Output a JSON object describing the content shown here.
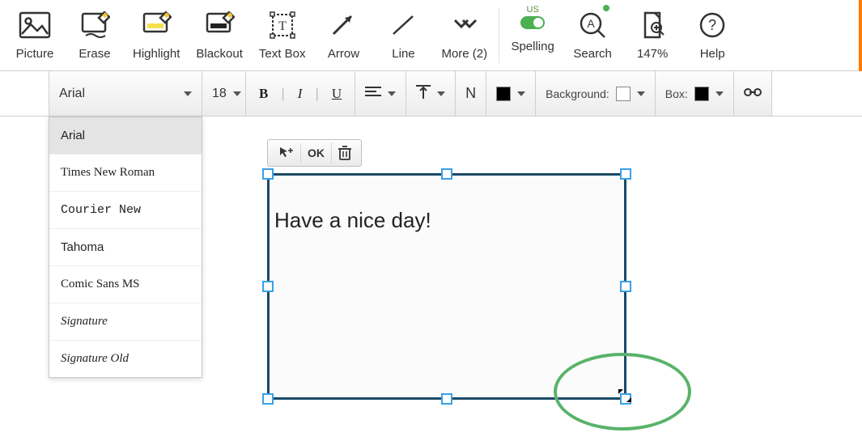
{
  "toolbar": {
    "picture": "Picture",
    "erase": "Erase",
    "highlight": "Highlight",
    "blackout": "Blackout",
    "textbox": "Text Box",
    "arrow": "Arrow",
    "line": "Line",
    "more": "More (2)",
    "spelling": "Spelling",
    "spelling_lang": "us",
    "search": "Search",
    "zoom": "147%",
    "help": "Help"
  },
  "format": {
    "font": "Arial",
    "size": "18",
    "bold": "B",
    "italic": "I",
    "underline": "U",
    "n_label": "N",
    "background_label": "Background:",
    "box_label": "Box:"
  },
  "font_dropdown": {
    "items": [
      "Arial",
      "Times New Roman",
      "Courier New",
      "Tahoma",
      "Comic Sans MS",
      "Signature",
      "Signature Old"
    ]
  },
  "object_toolbar": {
    "ok": "OK"
  },
  "textbox": {
    "content": "Have a nice day!"
  },
  "colors": {
    "text_swatch": "#000000",
    "background_swatch": "#ffffff",
    "box_swatch": "#000000",
    "selection_border": "#1a4a66",
    "handle_border": "#3aa0e8",
    "highlight_ellipse": "#59b36a",
    "toggle_on": "#4caf50",
    "accent_bar": "#ff7a00"
  }
}
